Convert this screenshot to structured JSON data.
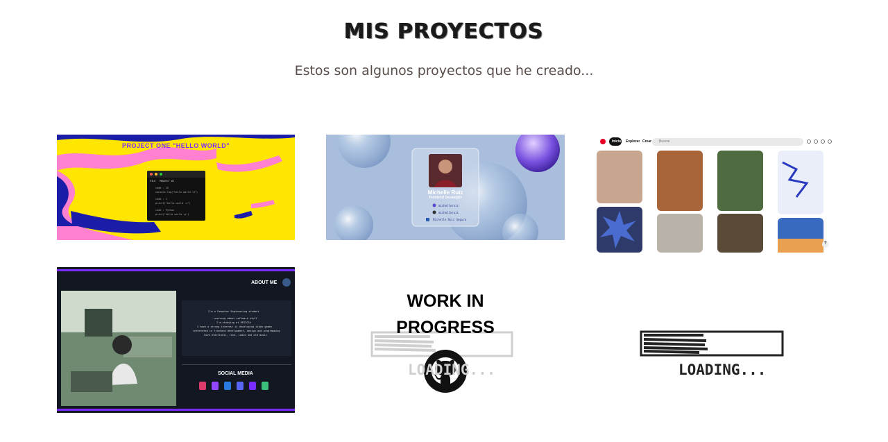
{
  "header": {
    "title": "MIS PROYECTOS",
    "subtitle": "Estos son algunos proyectos que he creado..."
  },
  "projects": [
    {
      "banner": "PROJECT ONE \"HELLO WORLD\"",
      "window_tabs": [
        "FILE",
        "PROJECT 01"
      ],
      "code_lines": [
        "code : JS",
        "console.log(\"hello world :D\")",
        "code : C",
        "printf(\"hello world :c\")",
        "code : Python",
        "print(\"hello world :p\")"
      ]
    },
    {
      "name": "Michelle Ruiz",
      "role": "Frontend Developer",
      "links": [
        "michelleruiz",
        "michelleruiz",
        "Michelle Ruiz Segura"
      ]
    },
    {
      "logo": "P",
      "tabs": [
        "Inicio",
        "Explorar",
        "Crear"
      ],
      "search_placeholder": "Buscar",
      "help": "?"
    },
    {
      "about_title": "ABOUT ME",
      "about_lines": [
        "I'm a Computer Engineering student",
        "Learning about software stuff",
        "I'm studying at UPIICSA",
        "I have a strong interest in developing video games",
        "interested in frontend development, design and programming",
        "Love electronic, rock, indie and old music"
      ],
      "social_title": "SOCIAL MEDIA"
    },
    {
      "title_line1": "WORK IN",
      "title_line2": "PROGRESS",
      "loading_text": "LOADING..."
    },
    {
      "loading_text": "LOADING..."
    }
  ],
  "colors": {
    "yellow": "#ffe600",
    "pink": "#ff7fd0",
    "navy": "#1b1ca8",
    "dark_panel": "#131722",
    "neon_purple": "#7a2cff"
  }
}
